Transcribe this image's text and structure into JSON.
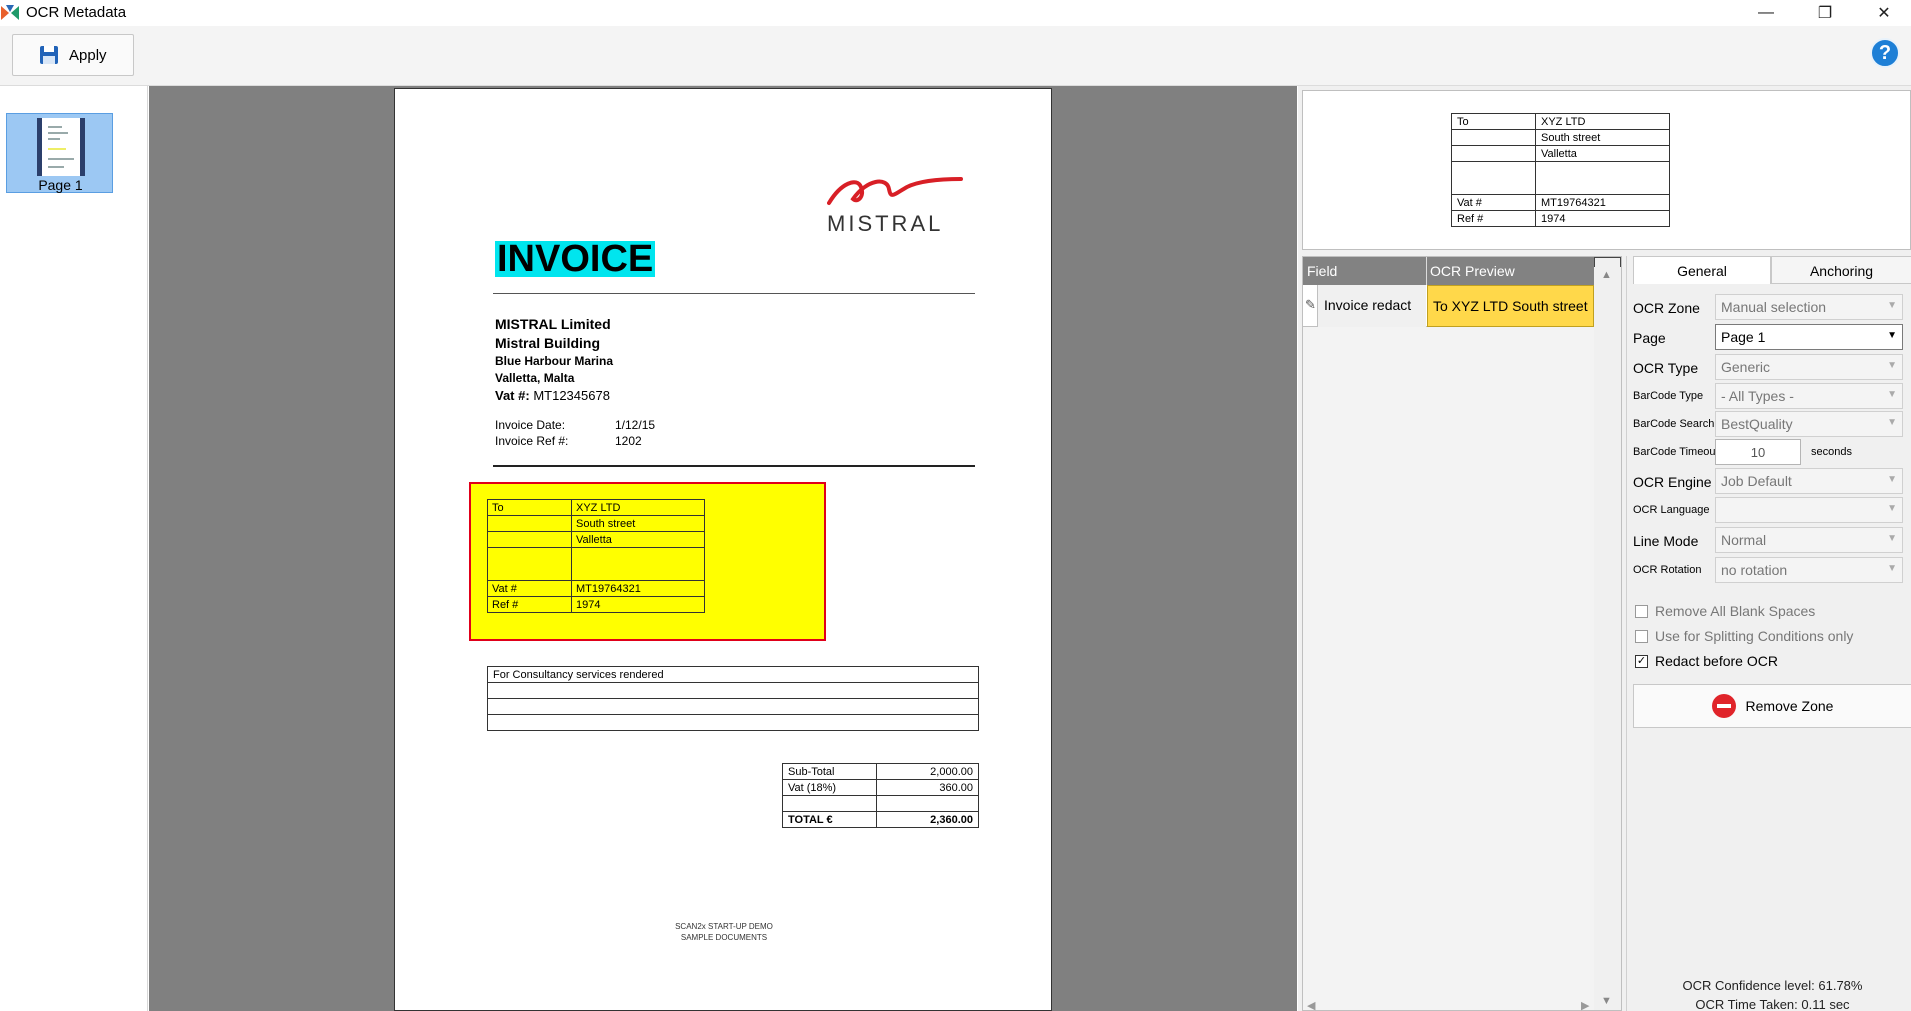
{
  "window": {
    "title": "OCR Metadata",
    "minimize": "—",
    "restore": "❐",
    "close": "✕"
  },
  "toolbar": {
    "apply_label": "Apply",
    "help_label": "?"
  },
  "thumbnails": {
    "items": [
      {
        "label": "Page 1"
      }
    ]
  },
  "document": {
    "logo": "MISTRAL",
    "title": "INVOICE",
    "company": {
      "name": "MISTRAL Limited",
      "building": "Mistral Building",
      "street": "Blue Harbour Marina",
      "city": "Valletta, Malta",
      "vat_label": "Vat #:",
      "vat_value": "MT12345678"
    },
    "invoice_date_label": "Invoice Date:",
    "invoice_date_value": "1/12/15",
    "invoice_ref_label": "Invoice Ref #:",
    "invoice_ref_value": "1202",
    "address_table": [
      [
        "To",
        "XYZ LTD"
      ],
      [
        "",
        "South street"
      ],
      [
        "",
        "Valletta"
      ],
      [
        "",
        ""
      ],
      [
        "Vat #",
        "MT19764321"
      ],
      [
        "Ref #",
        "1974"
      ]
    ],
    "services": [
      "For Consultancy services rendered",
      "",
      "",
      ""
    ],
    "totals": [
      [
        "Sub-Total",
        "2,000.00"
      ],
      [
        "Vat (18%)",
        "360.00"
      ],
      [
        "",
        ""
      ],
      [
        "TOTAL €",
        "2,360.00"
      ]
    ],
    "footer_line1": "SCAN2x START-UP DEMO",
    "footer_line2": "SAMPLE DOCUMENTS"
  },
  "zone_preview": {
    "table": [
      [
        "To",
        "XYZ LTD"
      ],
      [
        "",
        "South street"
      ],
      [
        "",
        "Valletta"
      ],
      [
        "",
        ""
      ],
      [
        "Vat #",
        "MT19764321"
      ],
      [
        "Ref #",
        "1974"
      ]
    ]
  },
  "grid": {
    "header_field": "Field",
    "header_preview": "OCR Preview",
    "rows": [
      {
        "field": "Invoice redact",
        "preview": "To XYZ LTD South street"
      }
    ]
  },
  "properties": {
    "tabs": [
      "General",
      "Anchoring"
    ],
    "ocr_zone_label": "OCR Zone",
    "ocr_zone_value": "Manual selection",
    "page_label": "Page",
    "page_value": "Page 1",
    "ocr_type_label": "OCR Type",
    "ocr_type_value": "Generic",
    "barcode_type_label": "BarCode Type",
    "barcode_type_value": "- All Types -",
    "barcode_search_label": "BarCode Search",
    "barcode_search_value": "BestQuality",
    "barcode_timeout_label": "BarCode Timeout",
    "barcode_timeout_value": "10",
    "barcode_timeout_unit": "seconds",
    "ocr_engine_label": "OCR Engine",
    "ocr_engine_value": "Job Default",
    "ocr_language_label": "OCR Language",
    "ocr_language_value": "",
    "line_mode_label": "Line Mode",
    "line_mode_value": "Normal",
    "ocr_rotation_label": "OCR Rotation",
    "ocr_rotation_value": "no rotation",
    "remove_blank_label": "Remove All Blank Spaces",
    "remove_blank_checked": false,
    "splitting_label": "Use for Splitting Conditions only",
    "splitting_checked": false,
    "redact_label": "Redact before OCR",
    "redact_checked": true,
    "remove_zone_label": "Remove Zone",
    "confidence_text": "OCR Confidence level: 61.78%",
    "time_text": "OCR Time Taken: 0.11 sec"
  }
}
